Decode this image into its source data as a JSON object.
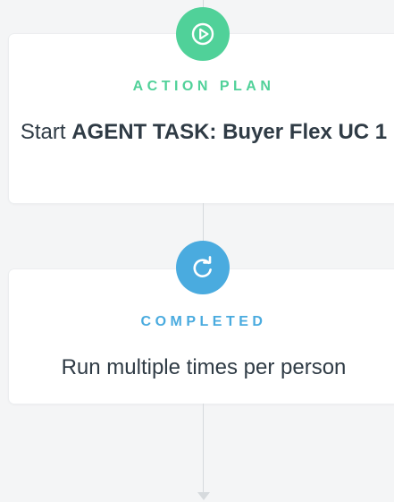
{
  "colors": {
    "action_green": "#50d199",
    "completed_blue": "#4aabdf",
    "connector": "#d6dadd",
    "text_dark": "#2f3b45"
  },
  "steps": [
    {
      "icon": "play-circle-icon",
      "status": "ACTION PLAN",
      "prefix": "Start ",
      "task_name": "AGENT TASK: Buyer Flex UC 1"
    },
    {
      "icon": "refresh-icon",
      "status": "COMPLETED",
      "description": "Run multiple times per person"
    }
  ]
}
